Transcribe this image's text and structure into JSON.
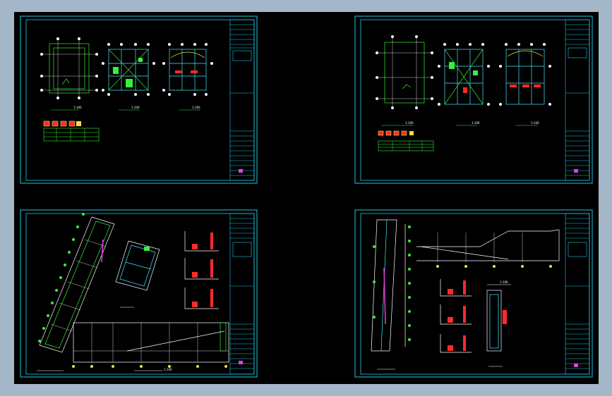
{
  "window": {
    "background": "#a3b7c9",
    "canvas_background": "#000000"
  },
  "colors": {
    "border": "#21c7e6",
    "line": "#35f13a",
    "dim": "#ffffff",
    "accent_red": "#ff2a2a",
    "accent_magenta": "#e040e0",
    "accent_yellow": "#f7e13b",
    "accent_cyan": "#43e9ff"
  },
  "sheets": [
    {
      "id": "sheet-1",
      "scale_labels": [
        "1:100",
        "1:100",
        "1:100"
      ]
    },
    {
      "id": "sheet-2",
      "scale_labels": [
        "1:100",
        "1:100",
        "1:100"
      ]
    },
    {
      "id": "sheet-3",
      "scale_labels": [
        "1:100"
      ]
    },
    {
      "id": "sheet-4",
      "scale_labels": [
        "1:100"
      ]
    }
  ]
}
